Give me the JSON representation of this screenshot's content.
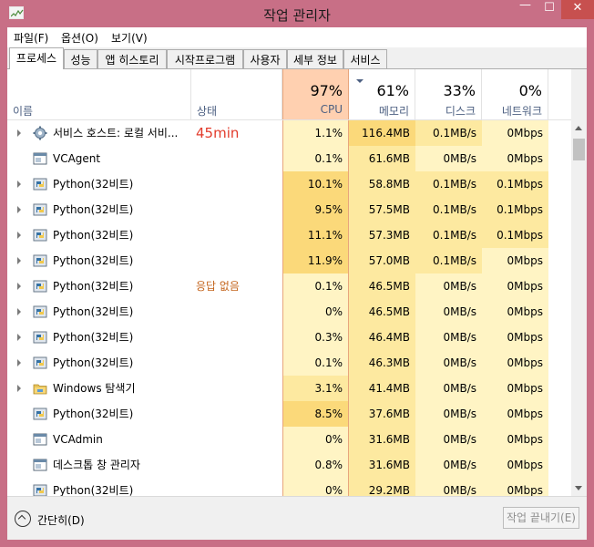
{
  "window": {
    "title": "작업 관리자",
    "controls": {
      "minimize": "—",
      "maximize": "☐",
      "close": "✕"
    }
  },
  "menu": [
    {
      "label": "파일(F)"
    },
    {
      "label": "옵션(O)"
    },
    {
      "label": "보기(V)"
    }
  ],
  "tabs": [
    {
      "label": "프로세스",
      "active": true
    },
    {
      "label": "성능"
    },
    {
      "label": "앱 히스토리"
    },
    {
      "label": "시작프로그램"
    },
    {
      "label": "사용자"
    },
    {
      "label": "세부 정보"
    },
    {
      "label": "서비스"
    }
  ],
  "columns": {
    "name": {
      "label": "이름"
    },
    "status": {
      "label": "상태"
    },
    "cpu": {
      "pct": "97%",
      "label": "CPU"
    },
    "memory": {
      "pct": "61%",
      "label": "메모리"
    },
    "disk": {
      "pct": "33%",
      "label": "디스크"
    },
    "network": {
      "pct": "0%",
      "label": "네트워크"
    }
  },
  "colors": {
    "frame": "#c86f86",
    "close": "#c7504f",
    "heat_light": "#fff4c4",
    "heat_mid": "#fde9a0",
    "heat_strong": "#fbd97a",
    "status_text": "#c4651e",
    "status_big": "#e23b2b"
  },
  "processes": [
    {
      "name": "서비스 호스트: 로컬 서비...",
      "icon": "gear-icon",
      "expandable": true,
      "status": "45min",
      "status_big": true,
      "cpu": "1.1%",
      "memory": "116.4MB",
      "disk": "0.1MB/s",
      "network": "0Mbps",
      "heat": [
        1,
        3,
        2,
        1
      ]
    },
    {
      "name": "VCAgent",
      "icon": "window-icon",
      "expandable": false,
      "status": "",
      "cpu": "0.1%",
      "memory": "61.6MB",
      "disk": "0MB/s",
      "network": "0Mbps",
      "heat": [
        1,
        2,
        1,
        1
      ]
    },
    {
      "name": "Python(32비트)",
      "icon": "python-icon",
      "expandable": true,
      "status": "",
      "cpu": "10.1%",
      "memory": "58.8MB",
      "disk": "0.1MB/s",
      "network": "0.1Mbps",
      "heat": [
        3,
        2,
        2,
        2
      ]
    },
    {
      "name": "Python(32비트)",
      "icon": "python-icon",
      "expandable": true,
      "status": "",
      "cpu": "9.5%",
      "memory": "57.5MB",
      "disk": "0.1MB/s",
      "network": "0.1Mbps",
      "heat": [
        3,
        2,
        2,
        2
      ]
    },
    {
      "name": "Python(32비트)",
      "icon": "python-icon",
      "expandable": true,
      "status": "",
      "cpu": "11.1%",
      "memory": "57.3MB",
      "disk": "0.1MB/s",
      "network": "0.1Mbps",
      "heat": [
        3,
        2,
        2,
        2
      ]
    },
    {
      "name": "Python(32비트)",
      "icon": "python-icon",
      "expandable": true,
      "status": "",
      "cpu": "11.9%",
      "memory": "57.0MB",
      "disk": "0.1MB/s",
      "network": "0Mbps",
      "heat": [
        3,
        2,
        2,
        1
      ]
    },
    {
      "name": "Python(32비트)",
      "icon": "python-icon",
      "expandable": true,
      "status": "응답 없음",
      "cpu": "0.1%",
      "memory": "46.5MB",
      "disk": "0MB/s",
      "network": "0Mbps",
      "heat": [
        1,
        2,
        1,
        1
      ]
    },
    {
      "name": "Python(32비트)",
      "icon": "python-icon",
      "expandable": true,
      "status": "",
      "cpu": "0%",
      "memory": "46.5MB",
      "disk": "0MB/s",
      "network": "0Mbps",
      "heat": [
        1,
        2,
        1,
        1
      ]
    },
    {
      "name": "Python(32비트)",
      "icon": "python-icon",
      "expandable": true,
      "status": "",
      "cpu": "0.3%",
      "memory": "46.4MB",
      "disk": "0MB/s",
      "network": "0Mbps",
      "heat": [
        1,
        2,
        1,
        1
      ]
    },
    {
      "name": "Python(32비트)",
      "icon": "python-icon",
      "expandable": true,
      "status": "",
      "cpu": "0.1%",
      "memory": "46.3MB",
      "disk": "0MB/s",
      "network": "0Mbps",
      "heat": [
        1,
        2,
        1,
        1
      ]
    },
    {
      "name": "Windows 탐색기",
      "icon": "folder-icon",
      "expandable": true,
      "status": "",
      "cpu": "3.1%",
      "memory": "41.4MB",
      "disk": "0MB/s",
      "network": "0Mbps",
      "heat": [
        2,
        2,
        1,
        1
      ]
    },
    {
      "name": "Python(32비트)",
      "icon": "python-icon",
      "expandable": false,
      "status": "",
      "cpu": "8.5%",
      "memory": "37.6MB",
      "disk": "0MB/s",
      "network": "0Mbps",
      "heat": [
        3,
        2,
        1,
        1
      ]
    },
    {
      "name": "VCAdmin",
      "icon": "window-icon",
      "expandable": false,
      "status": "",
      "cpu": "0%",
      "memory": "31.6MB",
      "disk": "0MB/s",
      "network": "0Mbps",
      "heat": [
        1,
        2,
        1,
        1
      ]
    },
    {
      "name": "데스크톱 창 관리자",
      "icon": "window-icon",
      "expandable": false,
      "status": "",
      "cpu": "0.8%",
      "memory": "31.6MB",
      "disk": "0MB/s",
      "network": "0Mbps",
      "heat": [
        1,
        2,
        1,
        1
      ]
    },
    {
      "name": "Python(32비트)",
      "icon": "python-icon",
      "expandable": false,
      "status": "",
      "cpu": "0%",
      "memory": "29.2MB",
      "disk": "0MB/s",
      "network": "0Mbps",
      "heat": [
        1,
        2,
        1,
        1
      ]
    }
  ],
  "footer": {
    "fewer_details": "간단히(D)",
    "end_task": "작업 끝내기(E)"
  }
}
